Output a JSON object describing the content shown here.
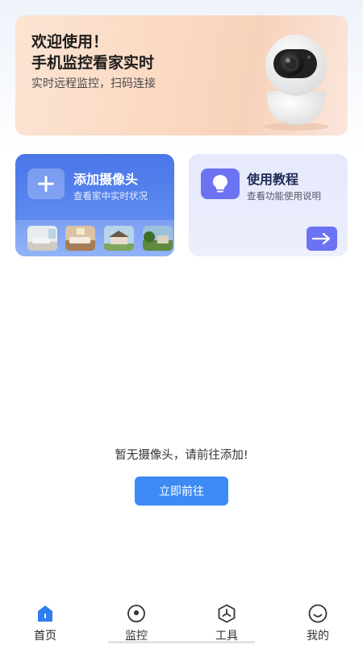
{
  "banner": {
    "title": "欢迎使用！\n手机监控看家实时",
    "subtitle": "实时远程监控，扫码连接"
  },
  "cards": {
    "add_camera": {
      "title": "添加摄像头",
      "subtitle": "查看家中实时状况"
    },
    "tutorial": {
      "title": "使用教程",
      "subtitle": "查看功能使用说明"
    }
  },
  "empty_state": {
    "message": "暂无摄像头，请前往添加!",
    "button_label": "立即前往"
  },
  "tabbar": {
    "items": [
      {
        "label": "首页",
        "icon": "home-icon",
        "active": true
      },
      {
        "label": "监控",
        "icon": "monitor-icon",
        "active": false
      },
      {
        "label": "工具",
        "icon": "tools-icon",
        "active": false
      },
      {
        "label": "我的",
        "icon": "profile-icon",
        "active": false
      }
    ]
  },
  "colors": {
    "accent": "#3d8af5",
    "add_card": "#4a76e8",
    "tutorial_accent": "#6b73f2"
  }
}
